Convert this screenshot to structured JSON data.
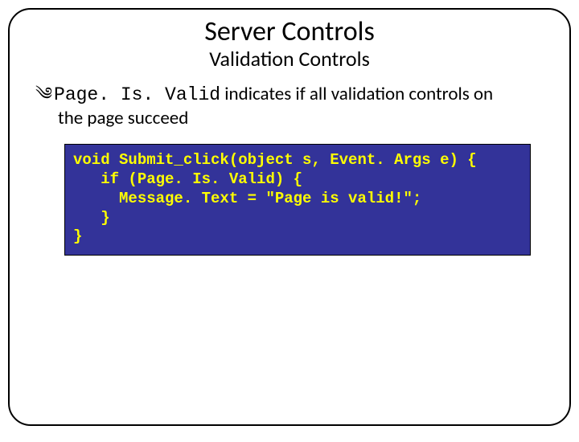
{
  "title": "Server Controls",
  "subtitle": "Validation Controls",
  "bullet": {
    "icon": "༄",
    "code": "Page. Is. Valid",
    "rest": " indicates if all validation controls on",
    "line2": "the page succeed"
  },
  "code": "void Submit_click(object s, Event. Args e) {\n   if (Page. Is. Valid) {\n     Message. Text = \"Page is valid!\";\n   }\n}"
}
